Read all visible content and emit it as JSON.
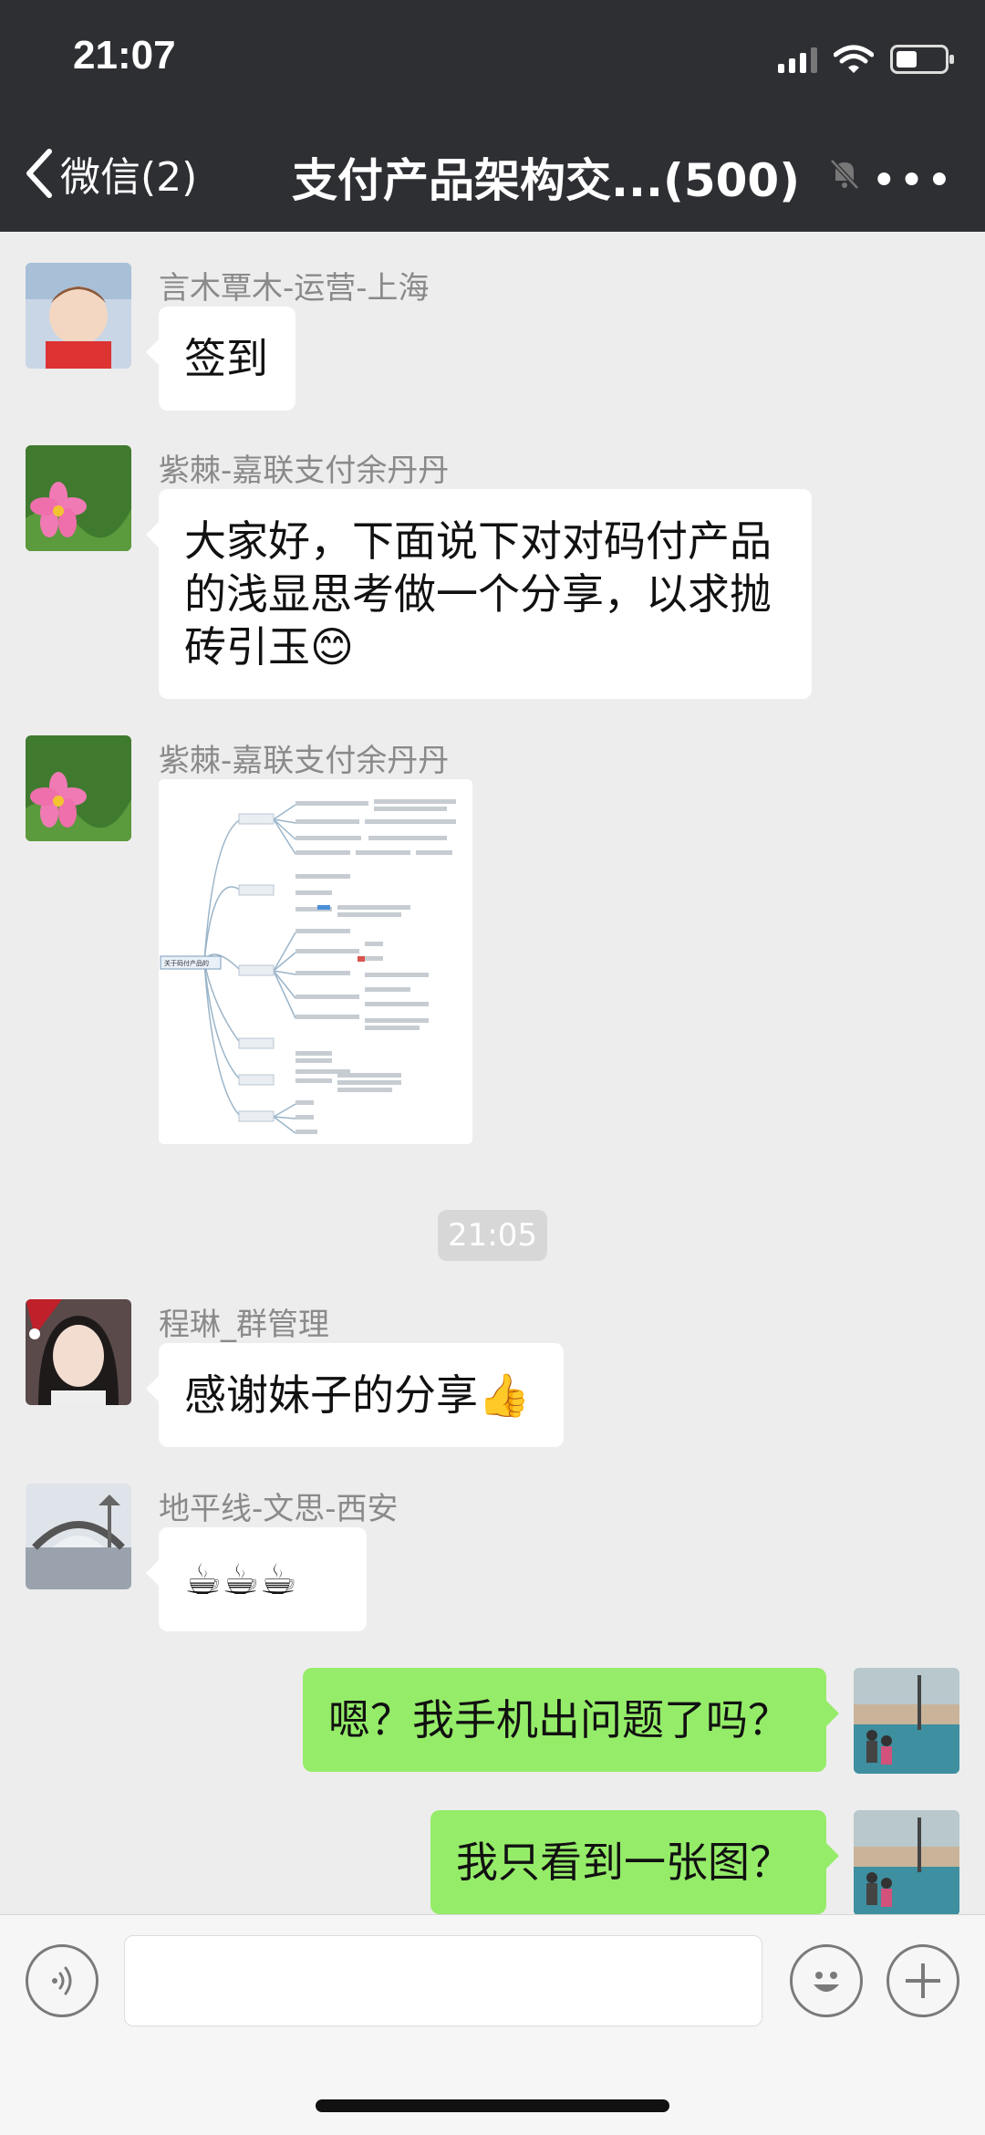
{
  "status_bar": {
    "time": "21:07"
  },
  "nav": {
    "back_label": "微信(2)",
    "title": "支付产品架构交...(500)"
  },
  "messages": [
    {
      "sender": "言木覃木-运营-上海",
      "text": "签到"
    },
    {
      "sender": "紫棘-嘉联支付余丹丹",
      "lines": [
        "大家好，下面说下对对码付产品",
        "的浅显思考做一个分享，以求抛",
        "砖引玉😊"
      ]
    },
    {
      "sender": "紫棘-嘉联支付余丹丹",
      "image_root_label": "关于码付产品的"
    },
    {
      "timestamp": "21:05"
    },
    {
      "sender": "程琳_群管理",
      "text": "感谢妹子的分享👍"
    },
    {
      "sender": "地平线-文思-西安",
      "text": "☕☕☕"
    },
    {
      "mine": true,
      "text": "嗯？我手机出问题了吗？"
    },
    {
      "mine": true,
      "text": "我只看到一张图？"
    }
  ],
  "colors": {
    "header_bg": "#2e2f33",
    "chat_bg": "#ededed",
    "own_bubble": "#95ec69",
    "other_bubble": "#ffffff"
  }
}
